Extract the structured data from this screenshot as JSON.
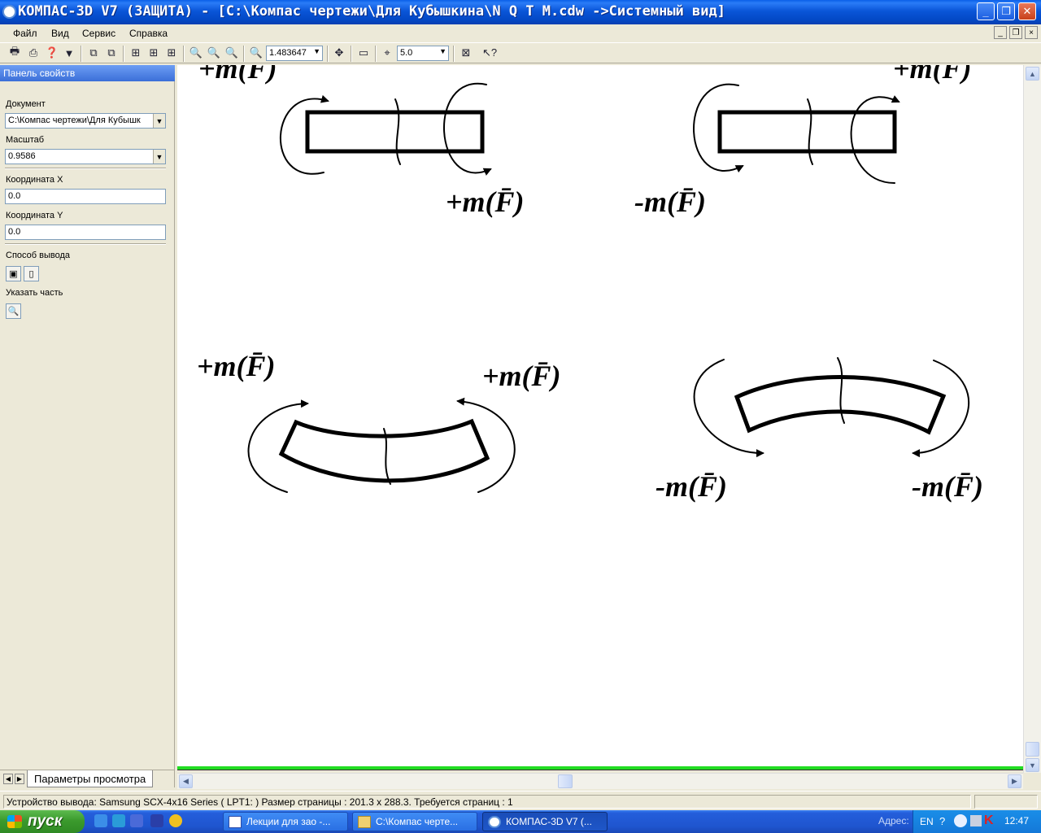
{
  "window": {
    "title": "КОМПАС-3D V7 (ЗАЩИТА) - [C:\\Компас чертежи\\Для Кубышкина\\N Q T M.cdw ->Системный вид]",
    "min_glyph": "_",
    "max_glyph": "❐",
    "close_glyph": "✕"
  },
  "menu": {
    "items": [
      "Файл",
      "Вид",
      "Сервис",
      "Справка"
    ],
    "mdi": [
      "_",
      "❐",
      "×"
    ]
  },
  "toolbar": {
    "zoom_value": "1.483647",
    "step_value": "5.0"
  },
  "panel": {
    "header": "Панель свойств",
    "document_label": "Документ",
    "document_value": "C:\\Компас чертежи\\Для Кубышк",
    "scale_label": "Масштаб",
    "scale_value": "0.9586",
    "coord_x_label": "Координата X",
    "coord_x_value": "0.0",
    "coord_y_label": "Координата Y",
    "coord_y_value": "0.0",
    "output_label": "Способ вывода",
    "part_label": "Указать часть",
    "tab_label": "Параметры просмотра"
  },
  "drawing": {
    "labels": [
      "+m(F̄)",
      "+m(F̄)",
      "+m(F̄)",
      "-m(F̄)",
      "+m(F̄)",
      "+m(F̄)",
      "-m(F̄)",
      "-m(F̄)"
    ]
  },
  "status": {
    "text": "Устройство вывода: Samsung SCX-4x16 Series ( LPT1: )  Размер страницы : 201.3 x 288.3.  Требуется страниц : 1"
  },
  "taskbar": {
    "start": "пуск",
    "tasks": [
      "Лекции для зао -...",
      "C:\\Компас черте...",
      "КОМПАС-3D V7 (..."
    ],
    "address_label": "Адрес:",
    "lang": "EN",
    "clock": "12:47"
  },
  "colors": {
    "titlebar": "#0a55d8",
    "taskbar": "#245edb",
    "start": "#3b9a2d",
    "highlight_line": "#22dd22"
  }
}
